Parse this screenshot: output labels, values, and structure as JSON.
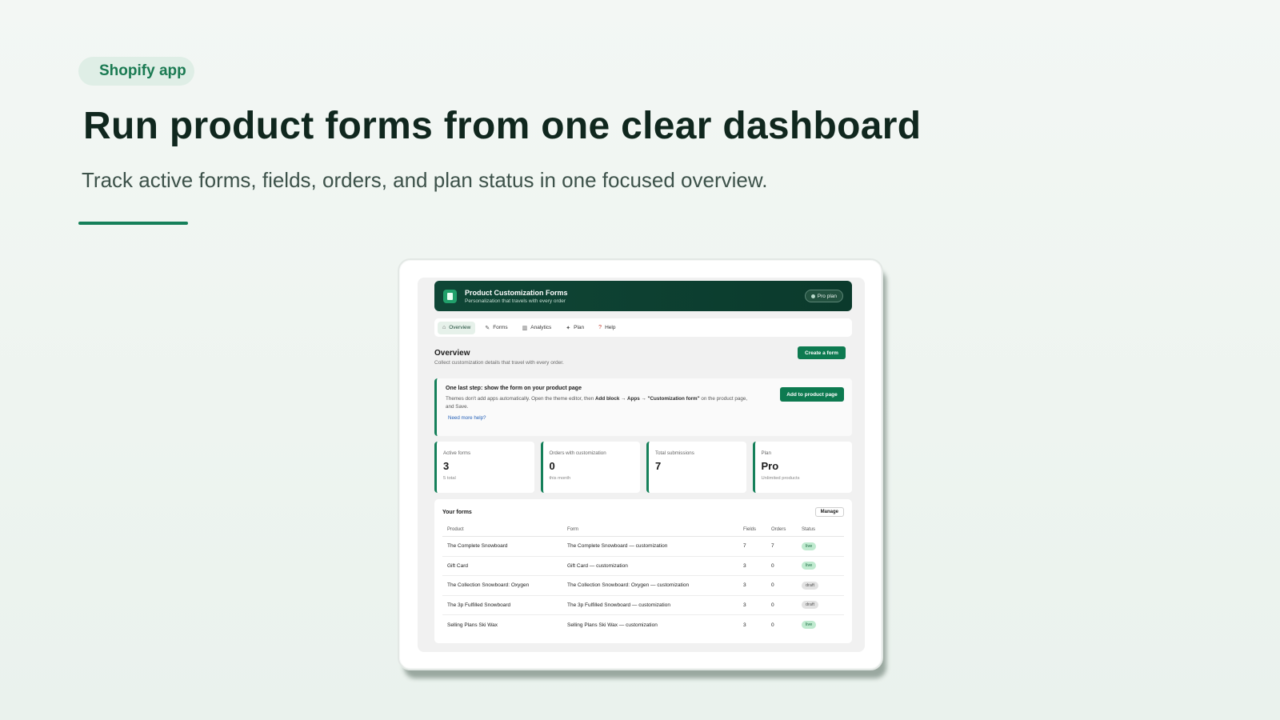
{
  "hero": {
    "badge": "Shopify app",
    "headline": "Run product forms from one clear dashboard",
    "subhead": "Track active forms, fields, orders, and plan status in one focused overview."
  },
  "app": {
    "title": "Product Customization Forms",
    "subtitle": "Personalization that travels with every order",
    "plan_pill": "Pro plan"
  },
  "tabs": [
    {
      "label": "Overview",
      "icon": "home-icon",
      "active": true
    },
    {
      "label": "Forms",
      "icon": "edit-icon"
    },
    {
      "label": "Analytics",
      "icon": "chart-icon"
    },
    {
      "label": "Plan",
      "icon": "sparkle-icon"
    },
    {
      "label": "Help",
      "icon": "question-icon"
    }
  ],
  "overview": {
    "title": "Overview",
    "subtitle": "Collect customization details that travel with every order.",
    "create_button": "Create a form"
  },
  "notice": {
    "title": "One last step: show the form on your product page",
    "body_prefix": "Themes don't add apps automatically. Open the theme editor, then ",
    "body_bold": "Add block → Apps → \"Customization form\"",
    "body_suffix": " on the product page, and Save.",
    "link": "Need more help?",
    "button": "Add to product page"
  },
  "stats": [
    {
      "label": "Active forms",
      "value": "3",
      "note": "5 total"
    },
    {
      "label": "Orders with customization",
      "value": "0",
      "note": "this month"
    },
    {
      "label": "Total submissions",
      "value": "7",
      "note": ""
    },
    {
      "label": "Plan",
      "value": "Pro",
      "note": "Unlimited products"
    }
  ],
  "forms": {
    "title": "Your forms",
    "manage_button": "Manage",
    "columns": [
      "Product",
      "Form",
      "Fields",
      "Orders",
      "Status"
    ],
    "rows": [
      {
        "product": "The Complete Snowboard",
        "form": "The Complete Snowboard — customization",
        "fields": "7",
        "orders": "7",
        "status": "live"
      },
      {
        "product": "Gift Card",
        "form": "Gift Card — customization",
        "fields": "3",
        "orders": "0",
        "status": "live"
      },
      {
        "product": "The Collection Snowboard: Oxygen",
        "form": "The Collection Snowboard: Oxygen — customization",
        "fields": "3",
        "orders": "0",
        "status": "draft"
      },
      {
        "product": "The 3p Fulfilled Snowboard",
        "form": "The 3p Fulfilled Snowboard — customization",
        "fields": "3",
        "orders": "0",
        "status": "draft"
      },
      {
        "product": "Selling Plans Ski Wax",
        "form": "Selling Plans Ski Wax — customization",
        "fields": "3",
        "orders": "0",
        "status": "live"
      }
    ]
  },
  "colors": {
    "accent": "#15805a",
    "appbar": "#0f4636",
    "live": "#bfeacf",
    "draft": "#e2e2e2"
  }
}
